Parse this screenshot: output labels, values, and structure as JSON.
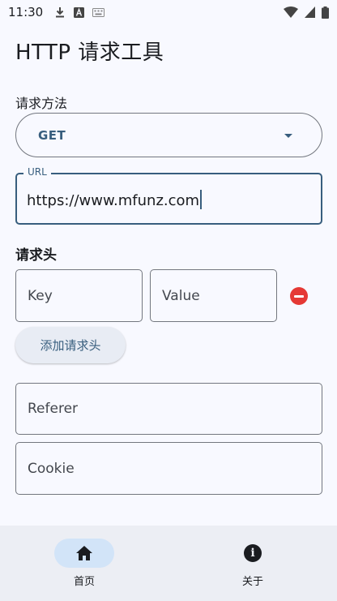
{
  "status_bar": {
    "time": "11:30",
    "icons": [
      "download-icon",
      "a-letter-icon",
      "keyboard-icon"
    ],
    "right_icons": [
      "wifi-icon",
      "signal-icon",
      "battery-icon"
    ]
  },
  "app_title": "HTTP 请求工具",
  "method": {
    "label": "请求方法",
    "value": "GET"
  },
  "url": {
    "label": "URL",
    "value": "https://www.mfunz.com"
  },
  "headers": {
    "title": "请求头",
    "key_placeholder": "Key",
    "value_placeholder": "Value",
    "add_button": "添加请求头"
  },
  "referer": {
    "placeholder": "Referer"
  },
  "cookie": {
    "placeholder": "Cookie"
  },
  "bottom_nav": {
    "items": [
      {
        "label": "首页",
        "icon": "home-icon",
        "active": true
      },
      {
        "label": "关于",
        "icon": "info-icon",
        "active": false
      }
    ]
  },
  "colors": {
    "background": "#F8F9FF",
    "accent": "#385E7E",
    "remove": "#E53935",
    "nav_bg": "#ECEEF4",
    "active_pill": "#D2E4F8"
  }
}
